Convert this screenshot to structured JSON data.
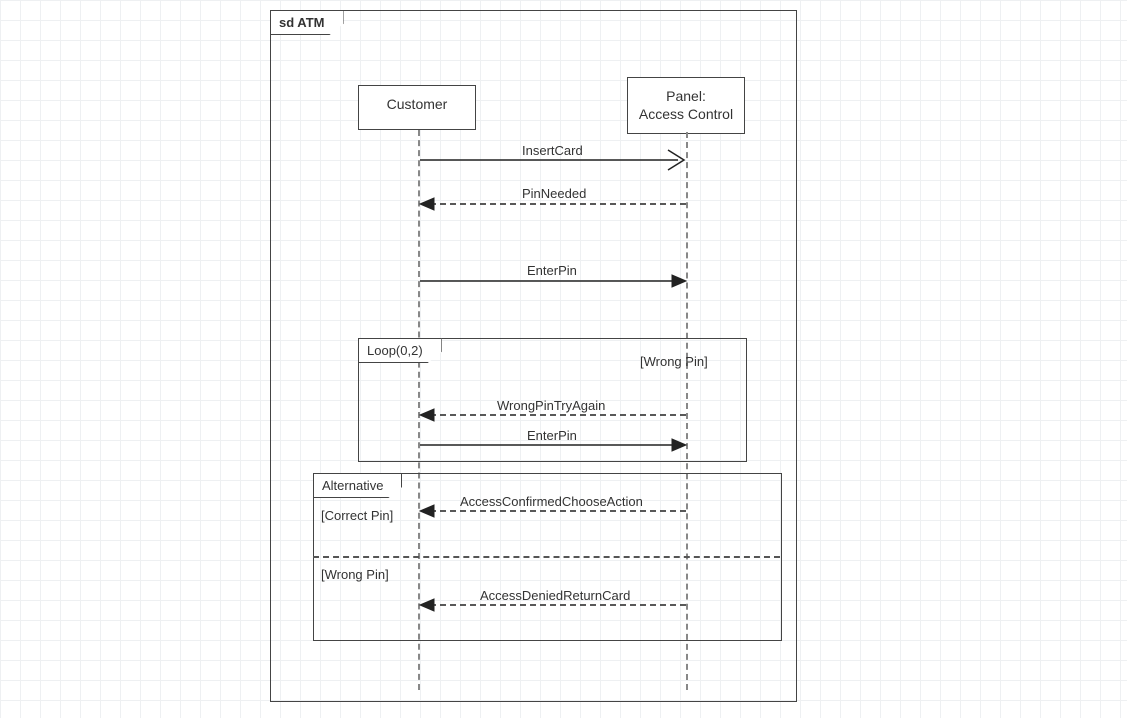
{
  "diagram": {
    "title": "sd ATM"
  },
  "lifelines": {
    "customer": "Customer",
    "panel_line1": "Panel:",
    "panel_line2": "Access Control"
  },
  "messages": {
    "insertCard": "InsertCard",
    "pinNeeded": "PinNeeded",
    "enterPin": "EnterPin",
    "wrongPinTryAgain": "WrongPinTryAgain",
    "enterPin2": "EnterPin",
    "accessConfirmed": "AccessConfirmedChooseAction",
    "accessDenied": "AccessDeniedReturnCard"
  },
  "fragments": {
    "loop": {
      "label": "Loop(0,2)",
      "guard": "[Wrong Pin]"
    },
    "alt": {
      "label": "Alternative",
      "guard1": "[Correct Pin]",
      "guard2": "[Wrong Pin]"
    }
  }
}
